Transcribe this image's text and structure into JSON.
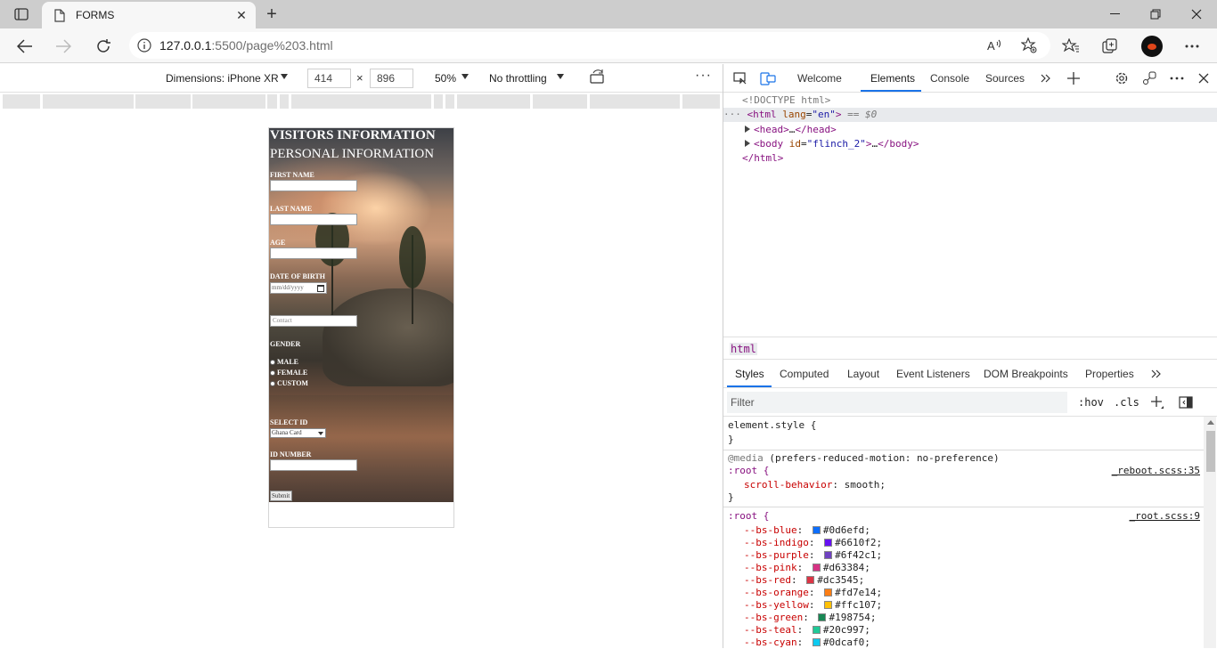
{
  "browser": {
    "tab": {
      "title": "FORMS"
    },
    "url": {
      "host": "127.0.0.1",
      "rest": ":5500/page%203.html"
    }
  },
  "device_toolbar": {
    "dimensions_label": "Dimensions: iPhone XR",
    "width": "414",
    "height": "896",
    "times": "×",
    "zoom": "50%",
    "throttling": "No throttling",
    "more": "···"
  },
  "page_form": {
    "heading": "VISITORS INFORMATION",
    "subheading": "PERSONAL INFORMATION",
    "first_name_label": "FIRST NAME",
    "last_name_label": "LAST NAME",
    "age_label": "AGE",
    "dob_label": "DATE OF BIRTH",
    "dob_placeholder": "mm/dd/yyyy",
    "contact_placeholder": "Contact",
    "gender_label": "GENDER",
    "gender_options": [
      "MALE",
      "FEMALE",
      "CUSTOM"
    ],
    "select_id_label": "SELECT ID",
    "select_id_value": "Ghana Card",
    "id_number_label": "ID NUMBER",
    "submit_label": "Submit"
  },
  "devtools": {
    "tabs": [
      "Welcome",
      "Elements",
      "Console",
      "Sources"
    ],
    "active_tab": "Elements",
    "dom": {
      "doctype": "<!DOCTYPE html>",
      "html_open_tag": "html",
      "html_attr_name": "lang",
      "html_attr_value": "\"en\"",
      "html_eq": "== $0",
      "head": "head",
      "head_ellipsis": "…",
      "body_tag": "body",
      "body_attr_name": "id",
      "body_attr_value": "\"flinch_2\"",
      "body_ellipsis": "…",
      "html_close": "</html>"
    },
    "breadcrumb": "html",
    "subtabs": [
      "Styles",
      "Computed",
      "Layout",
      "Event Listeners",
      "DOM Breakpoints",
      "Properties"
    ],
    "filter_placeholder": "Filter",
    "hov": ":hov",
    "cls": ".cls",
    "styles": {
      "element_style": "element.style {",
      "close_brace": "}",
      "media": "@media",
      "media_query": "(prefers-reduced-motion: no-preference)",
      "root1_selector": ":root {",
      "root1_src": "_reboot.scss:35",
      "scroll_prop": "scroll-behavior",
      "scroll_val": "smooth;",
      "root2_selector": ":root {",
      "root2_src": "_root.scss:9",
      "vars": [
        {
          "name": "--bs-blue",
          "value": "#0d6efd;",
          "color": "#0d6efd"
        },
        {
          "name": "--bs-indigo",
          "value": "#6610f2;",
          "color": "#6610f2"
        },
        {
          "name": "--bs-purple",
          "value": "#6f42c1;",
          "color": "#6f42c1"
        },
        {
          "name": "--bs-pink",
          "value": "#d63384;",
          "color": "#d63384"
        },
        {
          "name": "--bs-red",
          "value": "#dc3545;",
          "color": "#dc3545"
        },
        {
          "name": "--bs-orange",
          "value": "#fd7e14;",
          "color": "#fd7e14"
        },
        {
          "name": "--bs-yellow",
          "value": "#ffc107;",
          "color": "#ffc107"
        },
        {
          "name": "--bs-green",
          "value": "#198754;",
          "color": "#198754"
        },
        {
          "name": "--bs-teal",
          "value": "#20c997;",
          "color": "#20c997"
        },
        {
          "name": "--bs-cyan",
          "value": "#0dcaf0;",
          "color": "#0dcaf0"
        }
      ]
    }
  }
}
